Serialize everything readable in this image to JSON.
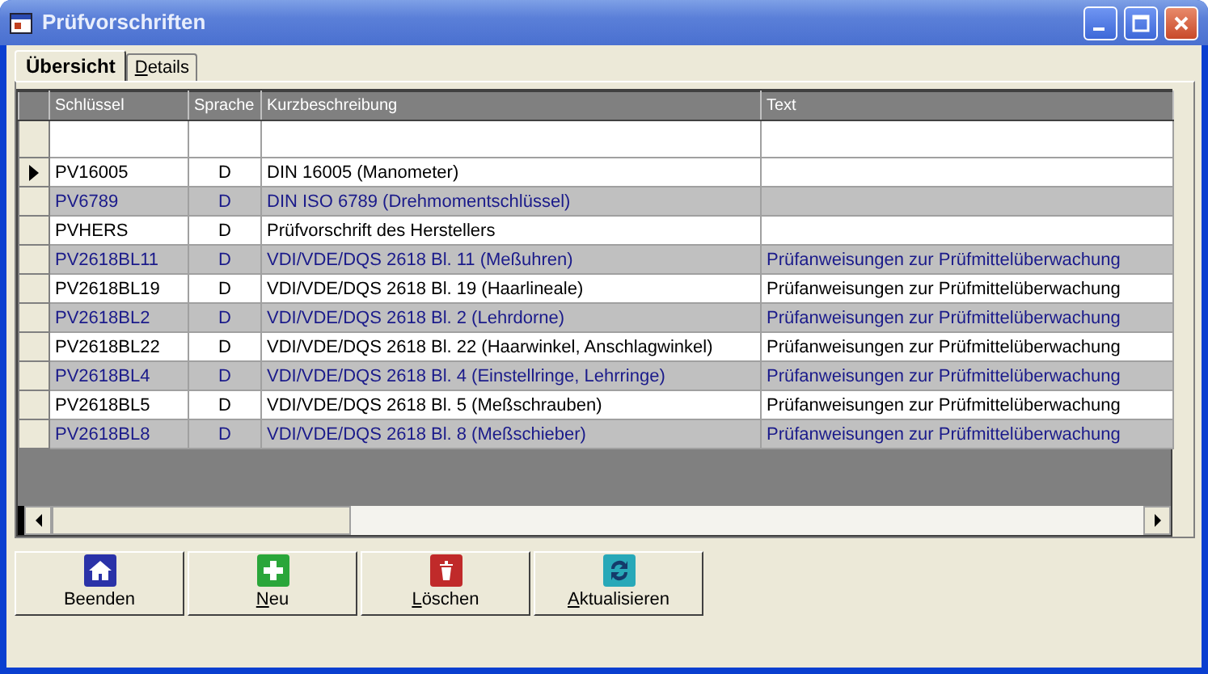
{
  "window": {
    "title": "Prüfvorschriften"
  },
  "tabs": [
    {
      "label": "Übersicht",
      "selected": true,
      "underline_first": false
    },
    {
      "label": "Details",
      "selected": false,
      "underline_first": true
    }
  ],
  "table": {
    "columns": [
      "Schlüssel",
      "Sprache",
      "Kurzbeschreibung",
      "Text"
    ],
    "rows": [
      {
        "current": true,
        "cells": [
          "PV16005",
          "D",
          "DIN 16005 (Manometer)",
          ""
        ]
      },
      {
        "current": false,
        "cells": [
          "PV6789",
          "D",
          "DIN ISO 6789 (Drehmomentschlüssel)",
          ""
        ]
      },
      {
        "current": false,
        "cells": [
          "PVHERS",
          "D",
          "Prüfvorschrift des Herstellers",
          ""
        ]
      },
      {
        "current": false,
        "cells": [
          "PV2618BL11",
          "D",
          "VDI/VDE/DQS 2618 Bl. 11 (Meßuhren)",
          "Prüfanweisungen zur Prüfmittelüberwachung"
        ]
      },
      {
        "current": false,
        "cells": [
          "PV2618BL19",
          "D",
          "VDI/VDE/DQS 2618 Bl. 19 (Haarlineale)",
          "Prüfanweisungen zur Prüfmittelüberwachung"
        ]
      },
      {
        "current": false,
        "cells": [
          "PV2618BL2",
          "D",
          "VDI/VDE/DQS 2618 Bl. 2 (Lehrdorne)",
          "Prüfanweisungen zur Prüfmittelüberwachung"
        ]
      },
      {
        "current": false,
        "cells": [
          "PV2618BL22",
          "D",
          "VDI/VDE/DQS 2618 Bl. 22 (Haarwinkel, Anschlagwinkel)",
          "Prüfanweisungen zur Prüfmittelüberwachung"
        ]
      },
      {
        "current": false,
        "cells": [
          "PV2618BL4",
          "D",
          "VDI/VDE/DQS 2618 Bl. 4 (Einstellringe, Lehrringe)",
          "Prüfanweisungen zur Prüfmittelüberwachung"
        ]
      },
      {
        "current": false,
        "cells": [
          "PV2618BL5",
          "D",
          "VDI/VDE/DQS 2618 Bl. 5 (Meßschrauben)",
          "Prüfanweisungen zur Prüfmittelüberwachung"
        ]
      },
      {
        "current": false,
        "cells": [
          "PV2618BL8",
          "D",
          "VDI/VDE/DQS 2618 Bl. 8 (Meßschieber)",
          "Prüfanweisungen zur Prüfmittelüberwachung"
        ]
      }
    ]
  },
  "buttons": [
    {
      "label": "Beenden",
      "kind": "home",
      "underline_first": false
    },
    {
      "label": "Neu",
      "kind": "add",
      "underline_first": true
    },
    {
      "label": "Löschen",
      "kind": "delete",
      "underline_first": true
    },
    {
      "label": "Aktualisieren",
      "kind": "refresh",
      "underline_first": true
    }
  ]
}
